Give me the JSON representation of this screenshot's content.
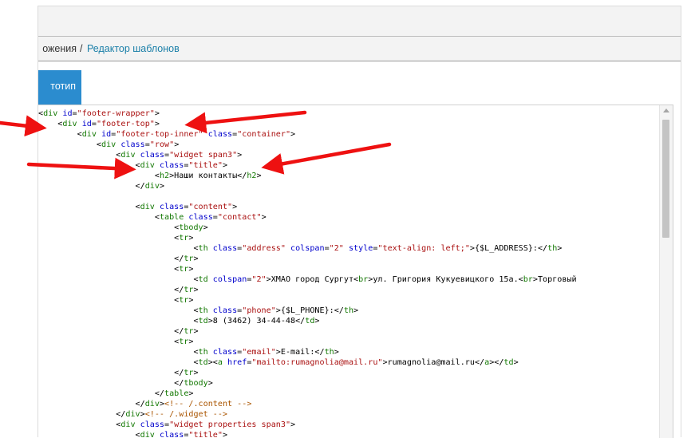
{
  "breadcrumb": {
    "previous": "ожения",
    "separator": "/",
    "current": "Редактор шаблонов"
  },
  "tab_button": {
    "label": "тотип"
  },
  "editor": {
    "lines": [
      [
        {
          "c": "x",
          "t": "<"
        },
        {
          "c": "t",
          "t": "div"
        },
        {
          "c": "x",
          "t": " "
        },
        {
          "c": "a",
          "t": "id"
        },
        {
          "c": "x",
          "t": "="
        },
        {
          "c": "s",
          "t": "\"footer-wrapper\""
        },
        {
          "c": "x",
          "t": ">"
        }
      ],
      [
        {
          "c": "x",
          "t": "    <"
        },
        {
          "c": "t",
          "t": "div"
        },
        {
          "c": "x",
          "t": " "
        },
        {
          "c": "a",
          "t": "id"
        },
        {
          "c": "x",
          "t": "="
        },
        {
          "c": "s",
          "t": "\"footer-top\""
        },
        {
          "c": "x",
          "t": ">"
        }
      ],
      [
        {
          "c": "x",
          "t": "        <"
        },
        {
          "c": "t",
          "t": "div"
        },
        {
          "c": "x",
          "t": " "
        },
        {
          "c": "a",
          "t": "id"
        },
        {
          "c": "x",
          "t": "="
        },
        {
          "c": "s",
          "t": "\"footer-top-inner\""
        },
        {
          "c": "x",
          "t": " "
        },
        {
          "c": "a",
          "t": "class"
        },
        {
          "c": "x",
          "t": "="
        },
        {
          "c": "s",
          "t": "\"container\""
        },
        {
          "c": "x",
          "t": ">"
        }
      ],
      [
        {
          "c": "x",
          "t": "            <"
        },
        {
          "c": "t",
          "t": "div"
        },
        {
          "c": "x",
          "t": " "
        },
        {
          "c": "a",
          "t": "class"
        },
        {
          "c": "x",
          "t": "="
        },
        {
          "c": "s",
          "t": "\"row\""
        },
        {
          "c": "x",
          "t": ">"
        }
      ],
      [
        {
          "c": "x",
          "t": "                <"
        },
        {
          "c": "t",
          "t": "div"
        },
        {
          "c": "x",
          "t": " "
        },
        {
          "c": "a",
          "t": "class"
        },
        {
          "c": "x",
          "t": "="
        },
        {
          "c": "s",
          "t": "\"widget span3\""
        },
        {
          "c": "x",
          "t": ">"
        }
      ],
      [
        {
          "c": "x",
          "t": "                    <"
        },
        {
          "c": "t",
          "t": "div"
        },
        {
          "c": "x",
          "t": " "
        },
        {
          "c": "a",
          "t": "class"
        },
        {
          "c": "x",
          "t": "="
        },
        {
          "c": "s",
          "t": "\"title\""
        },
        {
          "c": "x",
          "t": ">"
        }
      ],
      [
        {
          "c": "x",
          "t": "                        <"
        },
        {
          "c": "t",
          "t": "h2"
        },
        {
          "c": "x",
          "t": ">Наши контакты</"
        },
        {
          "c": "t",
          "t": "h2"
        },
        {
          "c": "x",
          "t": ">"
        }
      ],
      [
        {
          "c": "x",
          "t": "                    </"
        },
        {
          "c": "t",
          "t": "div"
        },
        {
          "c": "x",
          "t": ">"
        }
      ],
      [
        {
          "c": "x",
          "t": ""
        }
      ],
      [
        {
          "c": "x",
          "t": "                    <"
        },
        {
          "c": "t",
          "t": "div"
        },
        {
          "c": "x",
          "t": " "
        },
        {
          "c": "a",
          "t": "class"
        },
        {
          "c": "x",
          "t": "="
        },
        {
          "c": "s",
          "t": "\"content\""
        },
        {
          "c": "x",
          "t": ">"
        }
      ],
      [
        {
          "c": "x",
          "t": "                        <"
        },
        {
          "c": "t",
          "t": "table"
        },
        {
          "c": "x",
          "t": " "
        },
        {
          "c": "a",
          "t": "class"
        },
        {
          "c": "x",
          "t": "="
        },
        {
          "c": "s",
          "t": "\"contact\""
        },
        {
          "c": "x",
          "t": ">"
        }
      ],
      [
        {
          "c": "x",
          "t": "                            <"
        },
        {
          "c": "t",
          "t": "tbody"
        },
        {
          "c": "x",
          "t": ">"
        }
      ],
      [
        {
          "c": "x",
          "t": "                            <"
        },
        {
          "c": "t",
          "t": "tr"
        },
        {
          "c": "x",
          "t": ">"
        }
      ],
      [
        {
          "c": "x",
          "t": "                                <"
        },
        {
          "c": "t",
          "t": "th"
        },
        {
          "c": "x",
          "t": " "
        },
        {
          "c": "a",
          "t": "class"
        },
        {
          "c": "x",
          "t": "="
        },
        {
          "c": "s",
          "t": "\"address\""
        },
        {
          "c": "x",
          "t": " "
        },
        {
          "c": "a",
          "t": "colspan"
        },
        {
          "c": "x",
          "t": "="
        },
        {
          "c": "s",
          "t": "\"2\""
        },
        {
          "c": "x",
          "t": " "
        },
        {
          "c": "a",
          "t": "style"
        },
        {
          "c": "x",
          "t": "="
        },
        {
          "c": "s",
          "t": "\"text-align: left;\""
        },
        {
          "c": "x",
          "t": ">{$L_ADDRESS}:</"
        },
        {
          "c": "t",
          "t": "th"
        },
        {
          "c": "x",
          "t": ">"
        }
      ],
      [
        {
          "c": "x",
          "t": "                            </"
        },
        {
          "c": "t",
          "t": "tr"
        },
        {
          "c": "x",
          "t": ">"
        }
      ],
      [
        {
          "c": "x",
          "t": "                            <"
        },
        {
          "c": "t",
          "t": "tr"
        },
        {
          "c": "x",
          "t": ">"
        }
      ],
      [
        {
          "c": "x",
          "t": "                                <"
        },
        {
          "c": "t",
          "t": "td"
        },
        {
          "c": "x",
          "t": " "
        },
        {
          "c": "a",
          "t": "colspan"
        },
        {
          "c": "x",
          "t": "="
        },
        {
          "c": "s",
          "t": "\"2\""
        },
        {
          "c": "x",
          "t": ">ХМАО город Сургут<"
        },
        {
          "c": "t",
          "t": "br"
        },
        {
          "c": "x",
          "t": ">ул. Григория Кукуевицкого 15а.<"
        },
        {
          "c": "t",
          "t": "br"
        },
        {
          "c": "x",
          "t": ">Торговый"
        }
      ],
      [
        {
          "c": "x",
          "t": "                            </"
        },
        {
          "c": "t",
          "t": "tr"
        },
        {
          "c": "x",
          "t": ">"
        }
      ],
      [
        {
          "c": "x",
          "t": "                            <"
        },
        {
          "c": "t",
          "t": "tr"
        },
        {
          "c": "x",
          "t": ">"
        }
      ],
      [
        {
          "c": "x",
          "t": "                                <"
        },
        {
          "c": "t",
          "t": "th"
        },
        {
          "c": "x",
          "t": " "
        },
        {
          "c": "a",
          "t": "class"
        },
        {
          "c": "x",
          "t": "="
        },
        {
          "c": "s",
          "t": "\"phone\""
        },
        {
          "c": "x",
          "t": ">{$L_PHONE}:</"
        },
        {
          "c": "t",
          "t": "th"
        },
        {
          "c": "x",
          "t": ">"
        }
      ],
      [
        {
          "c": "x",
          "t": "                                <"
        },
        {
          "c": "t",
          "t": "td"
        },
        {
          "c": "x",
          "t": ">8 (3462) 34-44-48</"
        },
        {
          "c": "t",
          "t": "td"
        },
        {
          "c": "x",
          "t": ">"
        }
      ],
      [
        {
          "c": "x",
          "t": "                            </"
        },
        {
          "c": "t",
          "t": "tr"
        },
        {
          "c": "x",
          "t": ">"
        }
      ],
      [
        {
          "c": "x",
          "t": "                            <"
        },
        {
          "c": "t",
          "t": "tr"
        },
        {
          "c": "x",
          "t": ">"
        }
      ],
      [
        {
          "c": "x",
          "t": "                                <"
        },
        {
          "c": "t",
          "t": "th"
        },
        {
          "c": "x",
          "t": " "
        },
        {
          "c": "a",
          "t": "class"
        },
        {
          "c": "x",
          "t": "="
        },
        {
          "c": "s",
          "t": "\"email\""
        },
        {
          "c": "x",
          "t": ">E-mail:</"
        },
        {
          "c": "t",
          "t": "th"
        },
        {
          "c": "x",
          "t": ">"
        }
      ],
      [
        {
          "c": "x",
          "t": "                                <"
        },
        {
          "c": "t",
          "t": "td"
        },
        {
          "c": "x",
          "t": "><"
        },
        {
          "c": "t",
          "t": "a"
        },
        {
          "c": "x",
          "t": " "
        },
        {
          "c": "a",
          "t": "href"
        },
        {
          "c": "x",
          "t": "="
        },
        {
          "c": "s",
          "t": "\"mailto:rumagnolia@mail.ru\""
        },
        {
          "c": "x",
          "t": ">rumagnolia@mail.ru</"
        },
        {
          "c": "t",
          "t": "a"
        },
        {
          "c": "x",
          "t": "></"
        },
        {
          "c": "t",
          "t": "td"
        },
        {
          "c": "x",
          "t": ">"
        }
      ],
      [
        {
          "c": "x",
          "t": "                            </"
        },
        {
          "c": "t",
          "t": "tr"
        },
        {
          "c": "x",
          "t": ">"
        }
      ],
      [
        {
          "c": "x",
          "t": "                            </"
        },
        {
          "c": "t",
          "t": "tbody"
        },
        {
          "c": "x",
          "t": ">"
        }
      ],
      [
        {
          "c": "x",
          "t": "                        </"
        },
        {
          "c": "t",
          "t": "table"
        },
        {
          "c": "x",
          "t": ">"
        }
      ],
      [
        {
          "c": "x",
          "t": "                    </"
        },
        {
          "c": "t",
          "t": "div"
        },
        {
          "c": "x",
          "t": ">"
        },
        {
          "c": "c",
          "t": "<!-- /.content -->"
        }
      ],
      [
        {
          "c": "x",
          "t": "                </"
        },
        {
          "c": "t",
          "t": "div"
        },
        {
          "c": "x",
          "t": ">"
        },
        {
          "c": "c",
          "t": "<!-- /.widget -->"
        }
      ],
      [
        {
          "c": "x",
          "t": "                <"
        },
        {
          "c": "t",
          "t": "div"
        },
        {
          "c": "x",
          "t": " "
        },
        {
          "c": "a",
          "t": "class"
        },
        {
          "c": "x",
          "t": "="
        },
        {
          "c": "s",
          "t": "\"widget properties span3\""
        },
        {
          "c": "x",
          "t": ">"
        }
      ],
      [
        {
          "c": "x",
          "t": "                    <"
        },
        {
          "c": "t",
          "t": "div"
        },
        {
          "c": "x",
          "t": " "
        },
        {
          "c": "a",
          "t": "class"
        },
        {
          "c": "x",
          "t": "="
        },
        {
          "c": "s",
          "t": "\"title\""
        },
        {
          "c": "x",
          "t": ">"
        }
      ]
    ]
  },
  "colors": {
    "tag": "#117700",
    "attribute": "#0000cc",
    "string": "#aa1111",
    "comment": "#aa5500",
    "accent_button": "#2b8ccf",
    "link": "#1a7fa8",
    "annotation_arrow": "#ee1111"
  }
}
